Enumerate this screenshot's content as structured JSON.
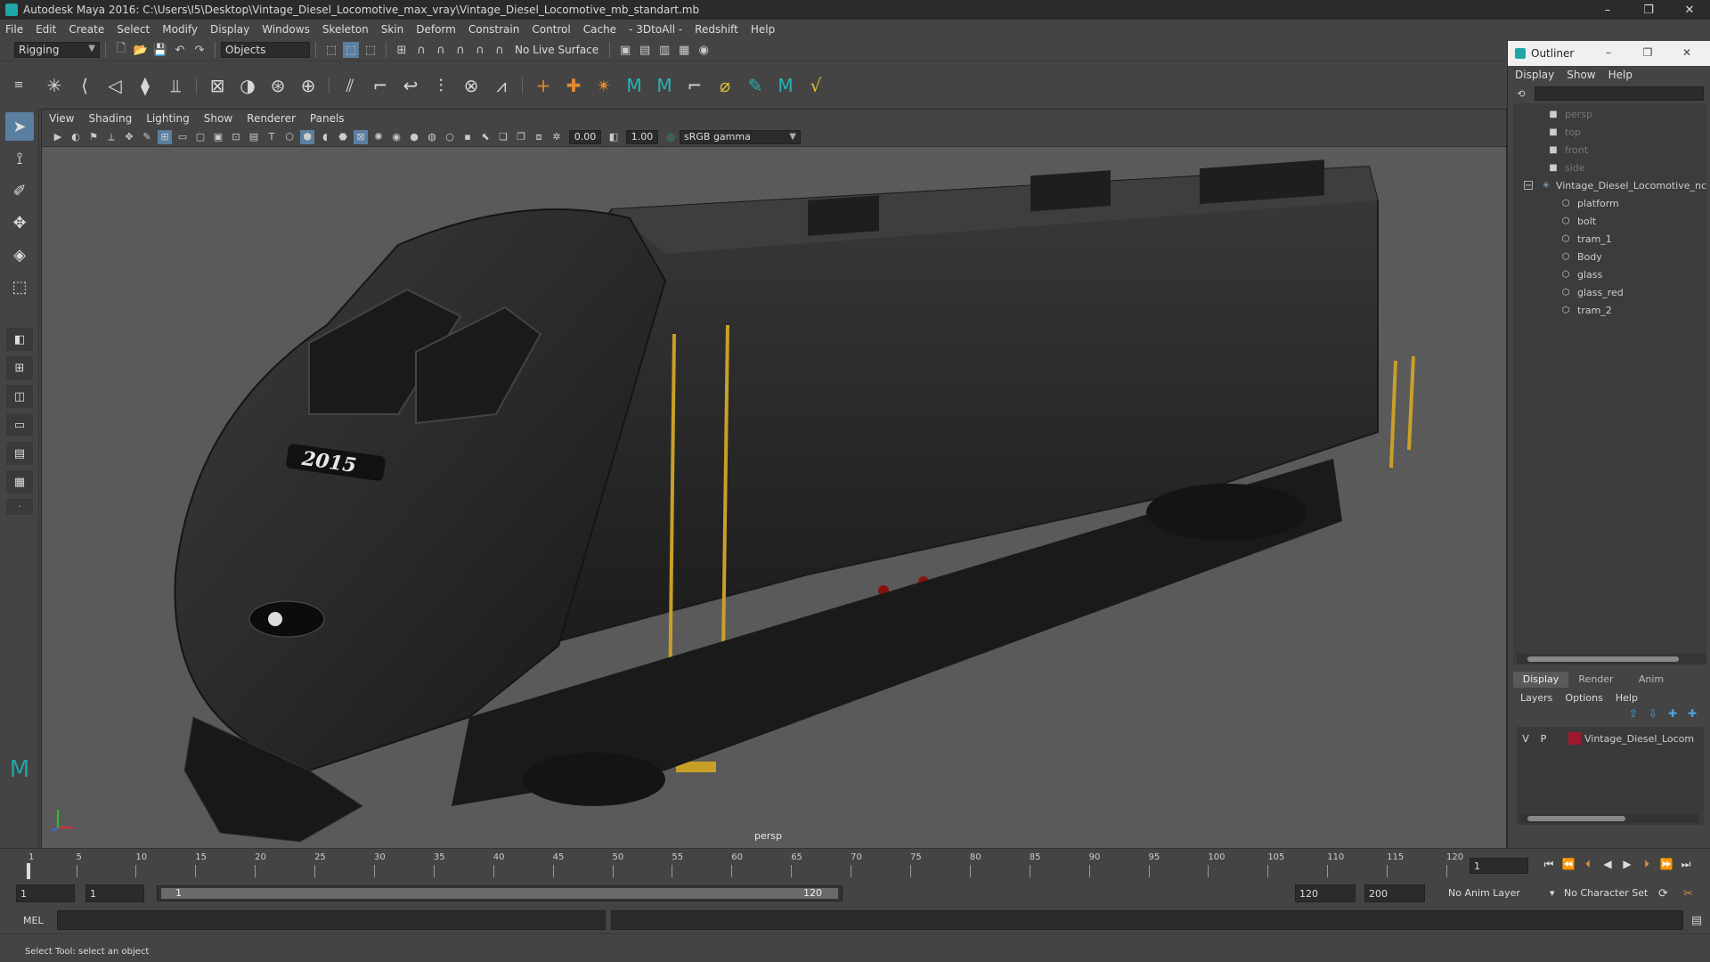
{
  "window": {
    "title": "Autodesk Maya 2016: C:\\Users\\I5\\Desktop\\Vintage_Diesel_Locomotive_max_vray\\Vintage_Diesel_Locomotive_mb_standart.mb",
    "controls": [
      "–",
      "❐",
      "✕"
    ]
  },
  "menubar": [
    "File",
    "Edit",
    "Create",
    "Select",
    "Modify",
    "Display",
    "Windows",
    "Skeleton",
    "Skin",
    "Deform",
    "Constrain",
    "Control",
    "Cache",
    "- 3DtoAll -",
    "Redshift",
    "Help"
  ],
  "statusline": {
    "menuset": "Rigging",
    "selection_mode": "Objects",
    "live_surface": "No Live Surface"
  },
  "viewport": {
    "menu": [
      "View",
      "Shading",
      "Lighting",
      "Show",
      "Renderer",
      "Panels"
    ],
    "exposure": "0.00",
    "gamma": "1.00",
    "colorspace": "sRGB gamma",
    "camera": "persp",
    "model_number": "2015"
  },
  "outliner": {
    "title": "Outliner",
    "menu": [
      "Display",
      "Show",
      "Help"
    ],
    "cameras": [
      "persp",
      "top",
      "front",
      "side"
    ],
    "group": "Vintage_Diesel_Locomotive_nc",
    "children": [
      "platform",
      "bolt",
      "tram_1",
      "Body",
      "glass",
      "glass_red",
      "tram_2"
    ]
  },
  "layers": {
    "tabs": [
      "Display",
      "Render",
      "Anim"
    ],
    "menu": [
      "Layers",
      "Options",
      "Help"
    ],
    "row": {
      "v": "V",
      "p": "P",
      "name": "Vintage_Diesel_Locom"
    }
  },
  "timeslider": {
    "ticks": [
      "1",
      "5",
      "10",
      "15",
      "20",
      "25",
      "30",
      "35",
      "40",
      "45",
      "50",
      "55",
      "60",
      "65",
      "70",
      "75",
      "80",
      "85",
      "90",
      "95",
      "100",
      "105",
      "110",
      "115",
      "120"
    ],
    "current_frame": "1"
  },
  "rangeslider": {
    "start": "1",
    "range_start": "1",
    "bar_start": "1",
    "bar_end": "120",
    "range_end": "120",
    "end": "200",
    "anim_layer": "No Anim Layer",
    "character_set": "No Character Set"
  },
  "cmdline": {
    "label": "MEL"
  },
  "helpline": {
    "text": "Select Tool: select an object"
  },
  "colors": {
    "accent": "#5a7fa0",
    "brand": "#1fa6a6",
    "layer": "#a01830"
  }
}
